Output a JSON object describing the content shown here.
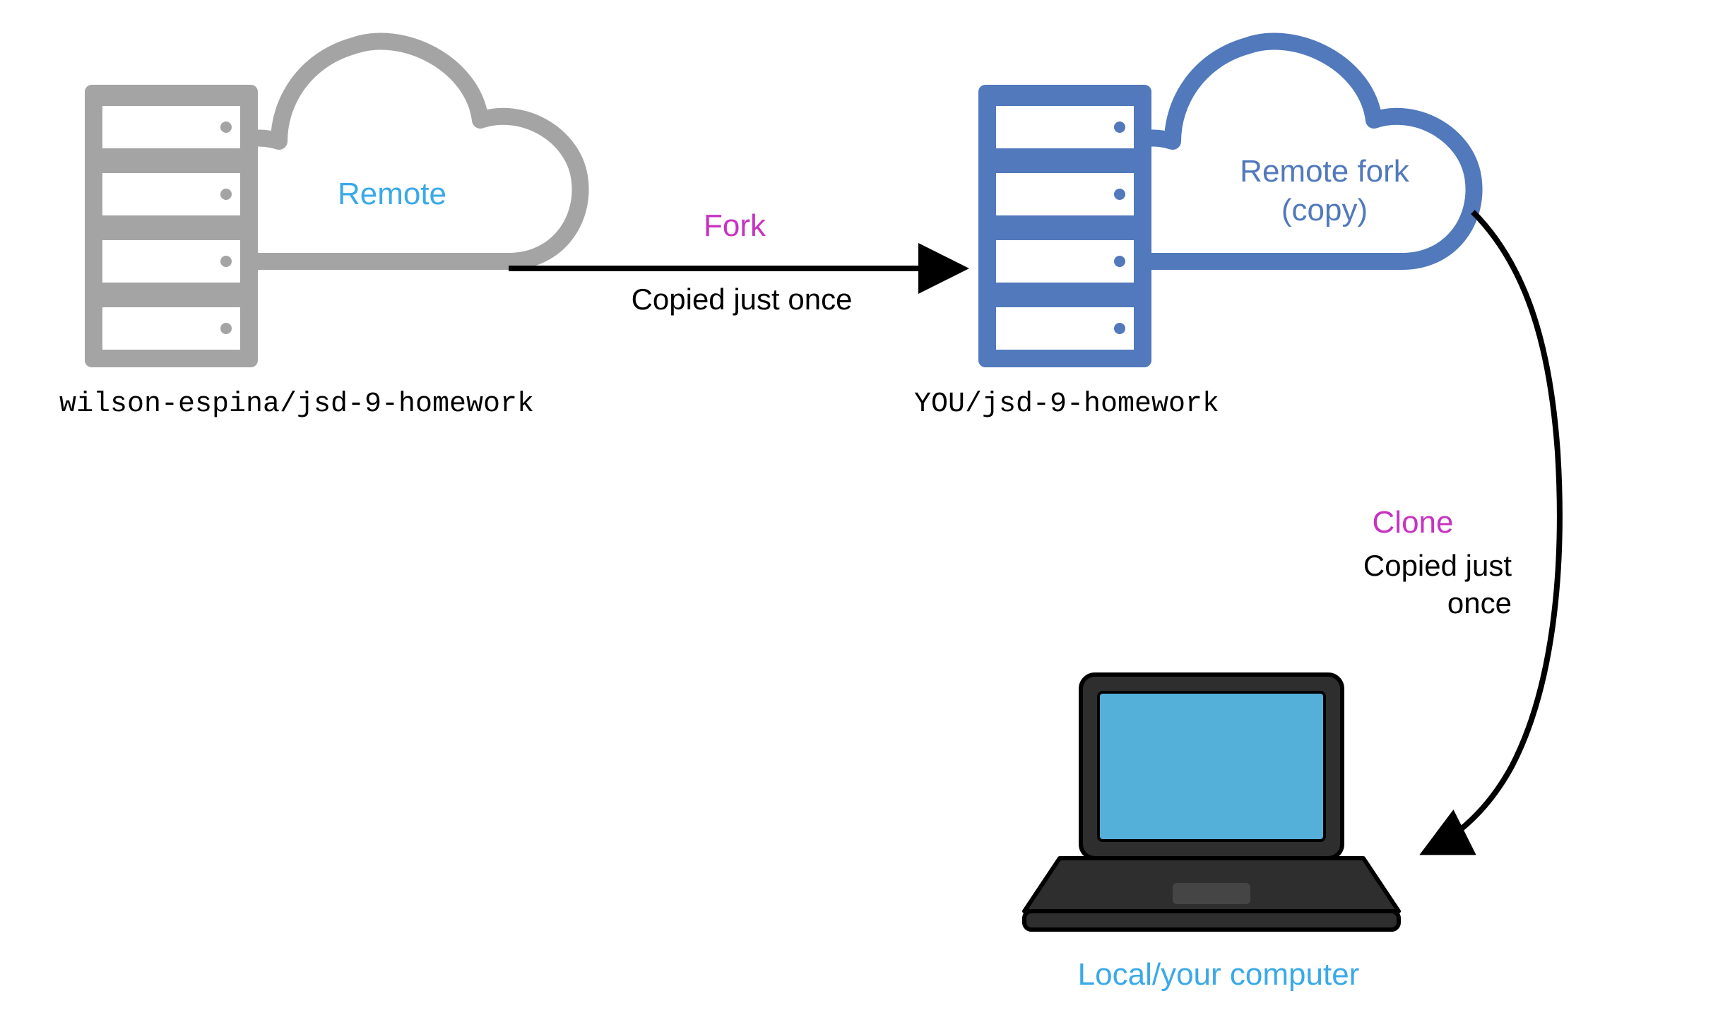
{
  "origin": {
    "repo_label": "wilson-espina/jsd-9-homework",
    "cloud_label": "Remote"
  },
  "fork": {
    "action_label": "Fork",
    "copy_label": "Copied just once",
    "repo_label": "YOU/jsd-9-homework",
    "cloud_label": "Remote fork\n(copy)"
  },
  "clone": {
    "action_label": "Clone",
    "copy_label": "Copied just\nonce"
  },
  "local": {
    "label": "Local/your computer"
  },
  "colors": {
    "gray": "#a4a4a4",
    "blue": "#5179bb",
    "light_blue": "#3aa9e8",
    "magenta": "#c733c1",
    "black": "#000000",
    "laptop_dark": "#2e2e2e",
    "laptop_screen": "#54b0d8"
  }
}
